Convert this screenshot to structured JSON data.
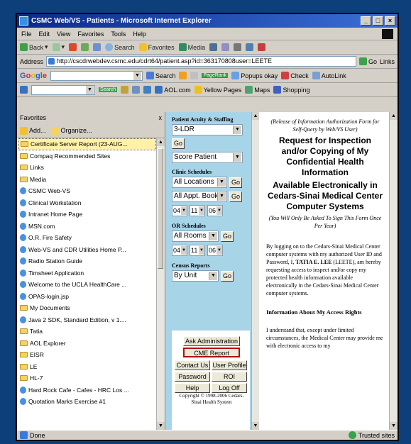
{
  "window": {
    "title": "CSMC Web/VS - Patients - Microsoft Internet Explorer"
  },
  "menu": [
    "File",
    "Edit",
    "View",
    "Favorites",
    "Tools",
    "Help"
  ],
  "toolbar": {
    "back": "Back",
    "search": "Search",
    "favorites": "Favorites",
    "media": "Media"
  },
  "address": {
    "label": "Address",
    "url": "http://cscdrwebdev.csmc.edu/cdrt64/patient.asp?id=363170808user=LEETE",
    "go": "Go",
    "links": "Links"
  },
  "google": {
    "brand": "Google",
    "search": "Search",
    "pagerank": "PageRank",
    "popups": "Popups okay",
    "check": "Check",
    "autolink": "AutoLink"
  },
  "linksbar": {
    "aol": "AOL.com",
    "yellow": "Yellow Pages",
    "maps": "Maps",
    "shopping": "Shopping",
    "search": "Search"
  },
  "favorites": {
    "header": "Favorites",
    "close": "x",
    "add": "Add...",
    "organize": "Organize...",
    "items": [
      {
        "label": "Certificate Server Report (23-AUG...",
        "type": "folder"
      },
      {
        "label": "Compaq Recommended Sites",
        "type": "folder"
      },
      {
        "label": "Links",
        "type": "folder"
      },
      {
        "label": "Media",
        "type": "folder"
      },
      {
        "label": "CSMC Web-VS",
        "type": "page"
      },
      {
        "label": "Clinical Workstation",
        "type": "page"
      },
      {
        "label": "Intranet Home Page",
        "type": "page"
      },
      {
        "label": "MSN.com",
        "type": "page"
      },
      {
        "label": "O.R. Fire Safety",
        "type": "page"
      },
      {
        "label": "Web-VS and CDR Utilities Home P...",
        "type": "page"
      },
      {
        "label": "Radio Station Guide",
        "type": "page"
      },
      {
        "label": "Timsheet Application",
        "type": "page"
      },
      {
        "label": "Welcome to the UCLA HealthCare ...",
        "type": "page"
      },
      {
        "label": "OPAS-login.jsp",
        "type": "page"
      },
      {
        "label": "My Documents",
        "type": "folder"
      },
      {
        "label": "Java 2 SDK, Standard Edition, v 1....",
        "type": "page"
      },
      {
        "label": "Tatia",
        "type": "folder"
      },
      {
        "label": "AOL Explorer",
        "type": "folder"
      },
      {
        "label": "EISR",
        "type": "folder"
      },
      {
        "label": "LE",
        "type": "folder"
      },
      {
        "label": "HL-7",
        "type": "folder"
      },
      {
        "label": "Hard Rock Cafe - Cafes - HRC Los ...",
        "type": "page"
      },
      {
        "label": "Quotation Marks Exercise #1",
        "type": "page"
      }
    ]
  },
  "nav": {
    "acuity_title": "Patient Acuity & Staffing",
    "acuity_unit": "3-LDR",
    "go": "Go",
    "score": "Score Patient",
    "clinic_title": "Clinic Schedules",
    "all_locations": "All Locations",
    "all_appt": "All Appt. Books",
    "date": {
      "m": "04",
      "d": "11",
      "y": "06"
    },
    "or_title": "OR Schedules",
    "all_rooms": "All Rooms",
    "census_title": "Census Reports",
    "by_unit": "By Unit",
    "ask_admin": "Ask Administration",
    "cme": "CME Report",
    "contact": "Contact Us",
    "profile": "User Profile",
    "password": "Password",
    "roi": "ROI",
    "help": "Help",
    "logoff": "Log Off",
    "copyright": "Copyright © 1998-2006 Cedars-Sinai Health System"
  },
  "doc": {
    "intro_italic": "(Release of Information Authorization Form for Self-Query by Web/VS User)",
    "heading1": "Request for Inspection and/or Copying of My Confidential Health Information",
    "heading2": "Available Electronically in Cedars-Sinai Medical Center Computer Systems",
    "note_italic": "(You Will Only Be Asked To Sign This Form Once Per Year)",
    "para1_a": "By logging on to the Cedars-Sinai Medical Center computer systems with my authorized User ID and Password, I, ",
    "para1_name": "TATIA E. LEE",
    "para1_b": " (LEETE), am hereby requesting access to inspect and/or copy my protected health information available electronically in the Cedars-Sinai Medical Center computer systems.",
    "section": "Information About My Access Rights",
    "para2": "I understand that, except under limited circumstances, the Medical Center may provide me with electronic access to my"
  },
  "status": {
    "left": "Done",
    "right": "Trusted sites"
  }
}
